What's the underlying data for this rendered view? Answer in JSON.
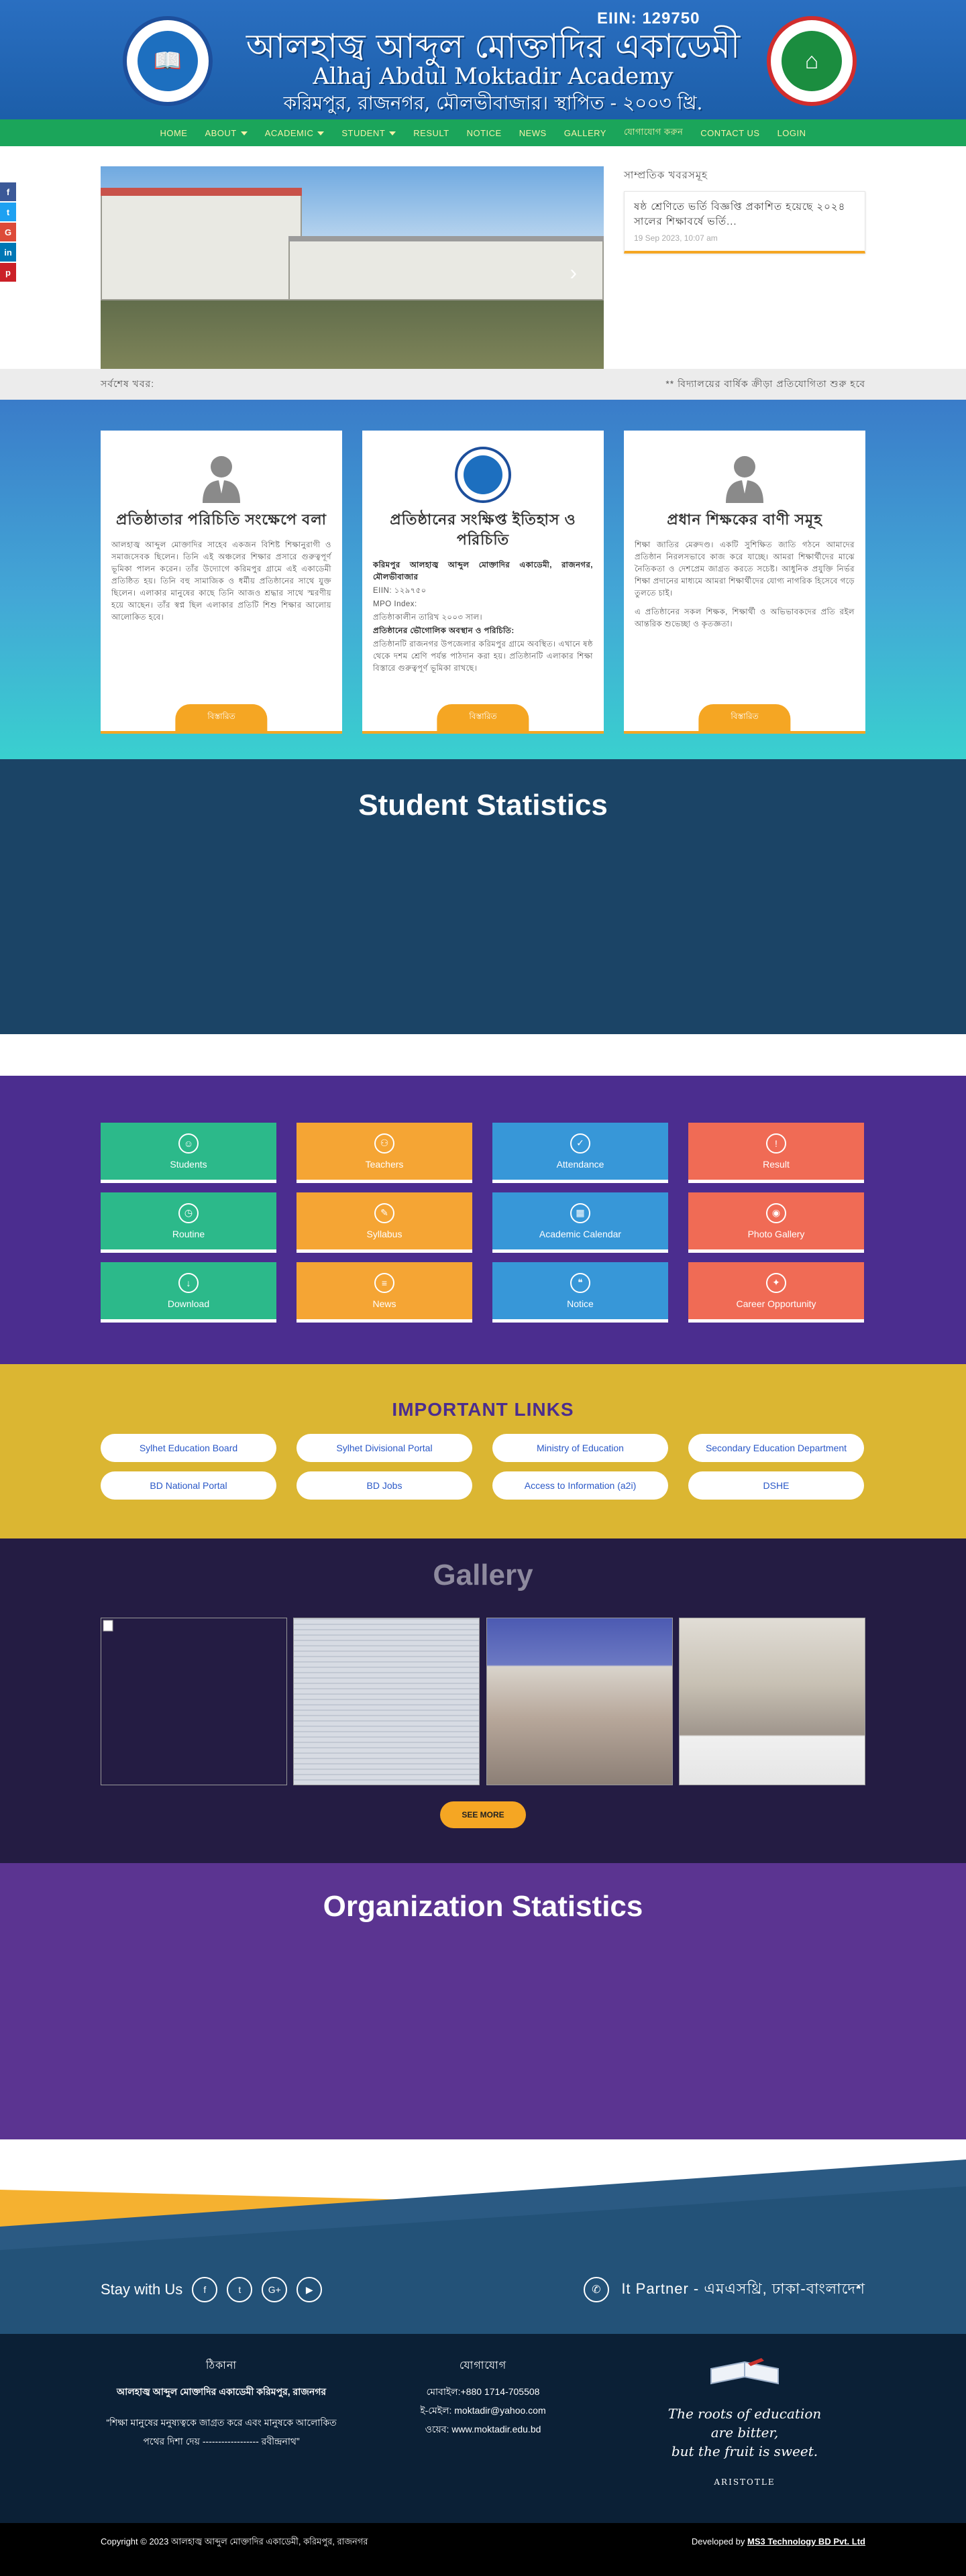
{
  "header": {
    "eiin": "EIIN: 129750",
    "title_bn": "আলহাজ্ব আব্দুল মোক্তাদির একাডেমী",
    "title_en": "Alhaj Abdul Moktadir Academy",
    "address_bn": "করিমপুর, রাজনগর, মৌলভীবাজার। স্থাপিত - ২০০৩ খ্রি."
  },
  "nav": {
    "items": [
      {
        "label": "HOME",
        "dropdown": false
      },
      {
        "label": "ABOUT",
        "dropdown": true
      },
      {
        "label": "ACADEMIC",
        "dropdown": true
      },
      {
        "label": "STUDENT",
        "dropdown": true
      },
      {
        "label": "RESULT",
        "dropdown": false
      },
      {
        "label": "NOTICE",
        "dropdown": false
      },
      {
        "label": "NEWS",
        "dropdown": false
      },
      {
        "label": "GALLERY",
        "dropdown": false
      },
      {
        "label": "যোগাযোগ করুন",
        "dropdown": false
      },
      {
        "label": "CONTACT US",
        "dropdown": false
      },
      {
        "label": "LOGIN",
        "dropdown": false
      }
    ]
  },
  "social_side": [
    {
      "icon": "facebook-icon",
      "glyph": "f",
      "color": "#3b5998"
    },
    {
      "icon": "twitter-icon",
      "glyph": "t",
      "color": "#1da1f2"
    },
    {
      "icon": "google-plus-icon",
      "glyph": "G",
      "color": "#dd4b39"
    },
    {
      "icon": "linkedin-icon",
      "glyph": "in",
      "color": "#0077b5"
    },
    {
      "icon": "pinterest-icon",
      "glyph": "p",
      "color": "#cb2027"
    }
  ],
  "notice_board": {
    "heading": "সাম্প্রতিক খবরসমূহ",
    "item_title": "ষষ্ঠ শ্রেণিতে ভর্তি বিজ্ঞপ্তি প্রকাশিত হয়েছে ২০২৪ সালের শিক্ষাবর্ষে ভর্তি...",
    "item_date": "19 Sep 2023, 10:07 am"
  },
  "ticker": {
    "left": "সর্বশেষ খবর:",
    "right": "** বিদ্যালয়ের বার্ষিক ক্রীড়া প্রতিযোগিতা শুরু হবে"
  },
  "profiles": [
    {
      "name": "প্রতিষ্ঠাতার পরিচিতি সংক্ষেপে বলা",
      "paragraphs": [
        "আলহাজ্ব আব্দুল মোক্তাদির সাহেব একজন বিশিষ্ট শিক্ষানুরাগী ও সমাজসেবক ছিলেন। তিনি এই অঞ্চলের শিক্ষার প্রসারে গুরুত্বপূর্ণ ভূমিকা পালন করেন। তাঁর উদ্যোগে করিমপুর গ্রামে এই একাডেমী প্রতিষ্ঠিত হয়। তিনি বহু সামাজিক ও ধর্মীয় প্রতিষ্ঠানের সাথে যুক্ত ছিলেন। এলাকার মানুষের কাছে তিনি আজও শ্রদ্ধার সাথে স্মরণীয় হয়ে আছেন। তাঁর স্বপ্ন ছিল এলাকার প্রতিটি শিশু শিক্ষার আলোয় আলোকিত হবে।"
      ],
      "button": "বিস্তারিত"
    },
    {
      "name": "প্রতিষ্ঠানের সংক্ষিপ্ত ইতিহাস ও পরিচিতি",
      "paragraphs": [
        "করিমপুর আলহাজ্ব আব্দুল মোক্তাদির একাডেমী, রাজনগর, মৌলভীবাজার",
        "EIIN: ১২৯৭৫০",
        "MPO Index:",
        "প্রতিষ্ঠাকালীন তারিখ ২০০৩ সাল।",
        "প্রতিষ্ঠানের ভৌগোলিক অবস্থান ও পরিচিতি:",
        "প্রতিষ্ঠানটি রাজনগর উপজেলার করিমপুর গ্রামে অবস্থিত। এখানে ষষ্ঠ থেকে দশম শ্রেণি পর্যন্ত পাঠদান করা হয়। প্রতিষ্ঠানটি এলাকার শিক্ষা বিস্তারে গুরুত্বপূর্ণ ভূমিকা রাখছে।"
      ],
      "button": "বিস্তারিত"
    },
    {
      "name": "প্রধান শিক্ষকের বাণী সমূহ",
      "paragraphs": [
        "শিক্ষা জাতির মেরুদণ্ড। একটি সুশিক্ষিত জাতি গঠনে আমাদের প্রতিষ্ঠান নিরলসভাবে কাজ করে যাচ্ছে। আমরা শিক্ষার্থীদের মাঝে নৈতিকতা ও দেশপ্রেম জাগ্রত করতে সচেষ্ট। আধুনিক প্রযুক্তি নির্ভর শিক্ষা প্রদানের মাধ্যমে আমরা শিক্ষার্থীদের যোগ্য নাগরিক হিসেবে গড়ে তুলতে চাই।",
        "এ প্রতিষ্ঠানের সকল শিক্ষক, শিক্ষার্থী ও অভিভাবকদের প্রতি রইল আন্তরিক শুভেচ্ছা ও কৃতজ্ঞতা।"
      ],
      "button": "বিস্তারিত"
    }
  ],
  "student_statistics": {
    "title": "Student Statistics"
  },
  "quick_links": [
    {
      "label": "Students",
      "icon": "students-icon",
      "glyph": "☺",
      "color": "green"
    },
    {
      "label": "Teachers",
      "icon": "teachers-icon",
      "glyph": "⚇",
      "color": "orange"
    },
    {
      "label": "Attendance",
      "icon": "check-icon",
      "glyph": "✓",
      "color": "blue"
    },
    {
      "label": "Result",
      "icon": "result-icon",
      "glyph": "!",
      "color": "red"
    },
    {
      "label": "Routine",
      "icon": "routine-icon",
      "glyph": "◷",
      "color": "green"
    },
    {
      "label": "Syllabus",
      "icon": "syllabus-icon",
      "glyph": "✎",
      "color": "orange"
    },
    {
      "label": "Academic Calendar",
      "icon": "calendar-icon",
      "glyph": "▦",
      "color": "blue"
    },
    {
      "label": "Photo Gallery",
      "icon": "camera-icon",
      "glyph": "◉",
      "color": "red"
    },
    {
      "label": "Download",
      "icon": "download-icon",
      "glyph": "↓",
      "color": "green"
    },
    {
      "label": "News",
      "icon": "news-icon",
      "glyph": "≡",
      "color": "orange"
    },
    {
      "label": "Notice",
      "icon": "notice-icon",
      "glyph": "❝",
      "color": "blue"
    },
    {
      "label": "Career Opportunity",
      "icon": "career-icon",
      "glyph": "✦",
      "color": "red"
    }
  ],
  "important_links": {
    "title": "IMPORTANT LINKS",
    "items": [
      "Sylhet Education Board",
      "Sylhet Divisional Portal",
      "Ministry of Education",
      "Secondary Education Department",
      "BD National Portal",
      "BD Jobs",
      "Access to Information (a2i)",
      "DSHE"
    ]
  },
  "gallery": {
    "title": "Gallery",
    "see_more": "SEE MORE"
  },
  "organization_statistics": {
    "title": "Organization Statistics"
  },
  "stay": {
    "label": "Stay with Us",
    "icons": [
      {
        "icon": "facebook-icon",
        "glyph": "f"
      },
      {
        "icon": "twitter-icon",
        "glyph": "t"
      },
      {
        "icon": "google-plus-icon",
        "glyph": "G+"
      },
      {
        "icon": "youtube-icon",
        "glyph": "▶"
      }
    ],
    "partner": "It Partner - এমএসথ্রি, ঢাকা-বাংলাদেশ"
  },
  "footer": {
    "col1_heading": "ঠিকানা",
    "col1_address": "আলহাজ্ব আব্দুল মোক্তাদির একাডেমী করিমপুর, রাজনগর",
    "col1_quote": "“শিক্ষা মানুষের মনুষ্যত্বকে জাগ্রত করে এবং মানুষকে আলোকিত পথের দিশা দেয় ------------------ রবীন্দ্রনাথ”",
    "col2_heading": "যোগাযোগ",
    "col2_phone": "মোবাইল:+880 1714-705508",
    "col2_email": "ই-মেইল: moktadir@yahoo.com",
    "col2_web": "ওয়েব: www.moktadir.edu.bd",
    "quote_lines": [
      "The roots of education",
      "are bitter,",
      "but the fruit is sweet."
    ],
    "quote_author": "ARISTOTLE"
  },
  "copyright": {
    "left": "Copyright © 2023 আলহাজ্ব আব্দুল মোক্তাদির একাডেমী, করিমপুর, রাজনগর",
    "right_prefix": "Developed by ",
    "right_link": "MS3 Technology BD Pvt. Ltd"
  }
}
